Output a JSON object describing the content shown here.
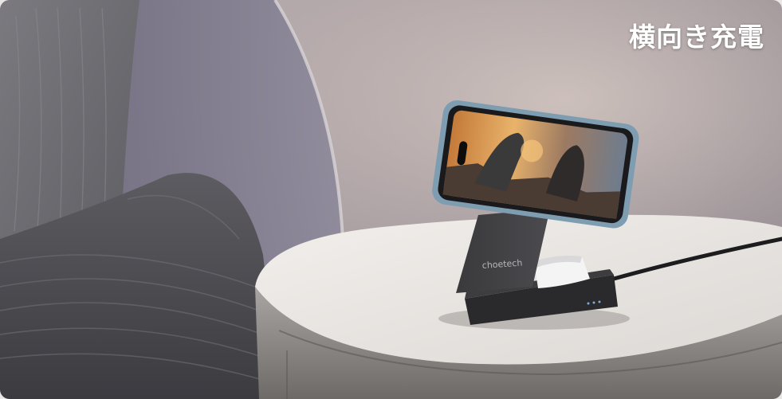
{
  "caption": {
    "text": "横向き充電"
  },
  "product": {
    "brand": "choetech"
  },
  "scene": {
    "subject": "magnetic-wireless-charging-stand",
    "colors": {
      "wall": "#a49ba0",
      "pillow": "#727174",
      "table_top": "#ece9e6",
      "device": "#3c3c3e",
      "phone_frame": "#7e9db1"
    }
  }
}
